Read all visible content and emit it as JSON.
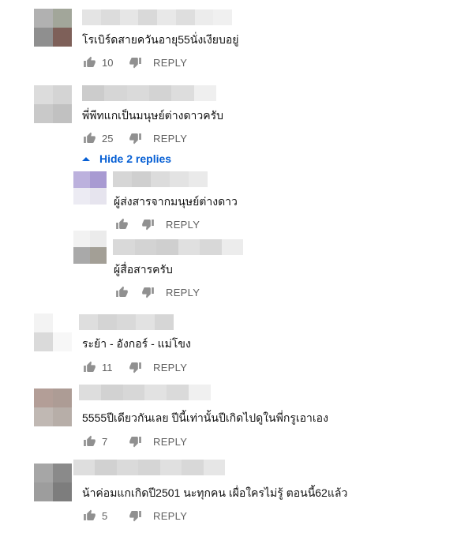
{
  "action_labels": {
    "reply": "REPLY"
  },
  "colors": {
    "link": "#065fd4",
    "meta": "#606060",
    "text": "#111111"
  },
  "hide_replies_label": "Hide 2 replies",
  "comments": [
    {
      "text": "โรเบิร์ดสายควันอายุ55นั่งเงียบอยู่",
      "likes": "10"
    },
    {
      "text": "พี่พีทแกเป็นมนุษย์ต่างดาวครับ",
      "likes": "25"
    },
    {
      "text": "ผู้ส่งสารจากมนุษย์ต่างดาว",
      "likes": ""
    },
    {
      "text": "ผู้สื่อสารครับ",
      "likes": ""
    },
    {
      "text": "ระย้า - อังกอร์ - แม่โขง",
      "likes": "11"
    },
    {
      "text": "5555ปีเดียวกันเลย  ปีนี้เท่านั้นปีเกิดไปดูในพี่กรูเอาเอง",
      "likes": "7"
    },
    {
      "text": "น้าค่อมแกเกิดปี2501 นะทุกคน เผื่อใครไม่รู้ ตอนนี้62แล้ว",
      "likes": "5"
    }
  ]
}
